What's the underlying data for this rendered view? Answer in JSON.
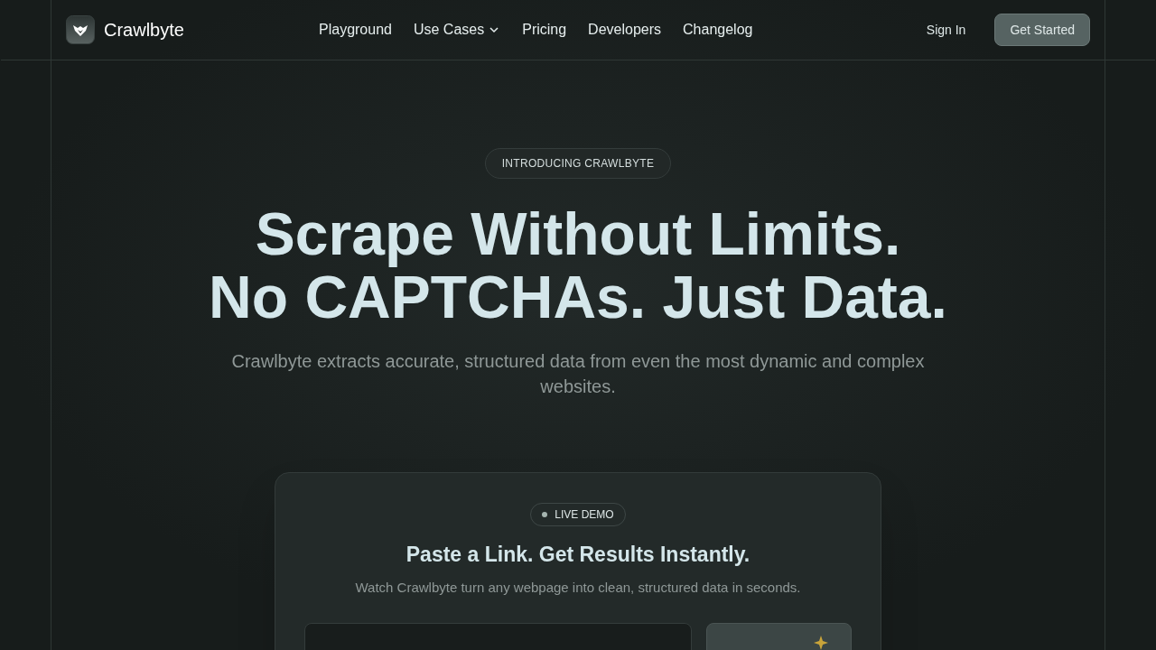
{
  "brand": {
    "name": "Crawlbyte"
  },
  "nav": [
    {
      "label": "Playground",
      "kind": "link"
    },
    {
      "label": "Use Cases",
      "kind": "dropdown"
    },
    {
      "label": "Pricing",
      "kind": "link"
    },
    {
      "label": "Developers",
      "kind": "link"
    },
    {
      "label": "Changelog",
      "kind": "link"
    }
  ],
  "actions": {
    "sign_in": "Sign In",
    "get_started": "Get Started"
  },
  "hero": {
    "badge": "INTRODUCING CRAWLBYTE",
    "title_lines": [
      "Scrape Without Limits.",
      "No CAPTCHAs. Just Data."
    ],
    "subtitle": "Crawlbyte extracts accurate, structured data from even the most dynamic and complex websites."
  },
  "demo": {
    "badge": "LIVE DEMO",
    "title": "Paste a Link. Get Results Instantly.",
    "subtitle": "Watch Crawlbyte turn any webpage into clean, structured data in seconds."
  }
}
